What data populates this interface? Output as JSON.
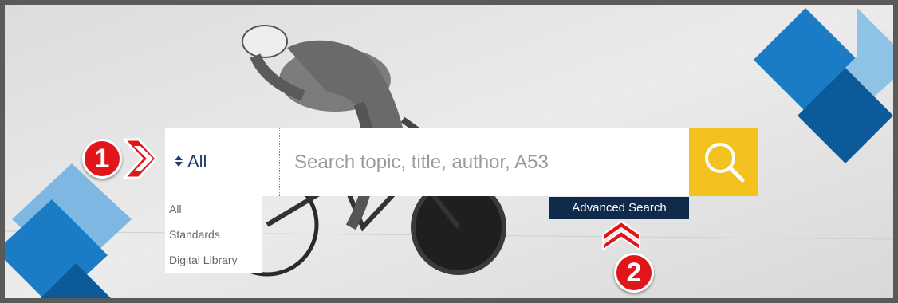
{
  "search": {
    "scope_value": "All",
    "placeholder": "Search topic, title, author, A53",
    "scope_options": [
      "All",
      "Standards",
      "Digital Library"
    ]
  },
  "advanced_search_label": "Advanced Search",
  "annotations": {
    "step_one": "1",
    "step_two": "2"
  },
  "colors": {
    "accent_yellow": "#f4c21e",
    "navy": "#0f2a4a",
    "badge_red": "#e0161b",
    "blue_light": "#5fb0e0",
    "blue_mid": "#1a7cc4",
    "blue_dark": "#0d5a9a"
  },
  "icons": {
    "search": "search-icon",
    "updown": "updown-icon",
    "chevron": "chevron-right-icon",
    "chevrons_up": "chevrons-up-icon"
  }
}
